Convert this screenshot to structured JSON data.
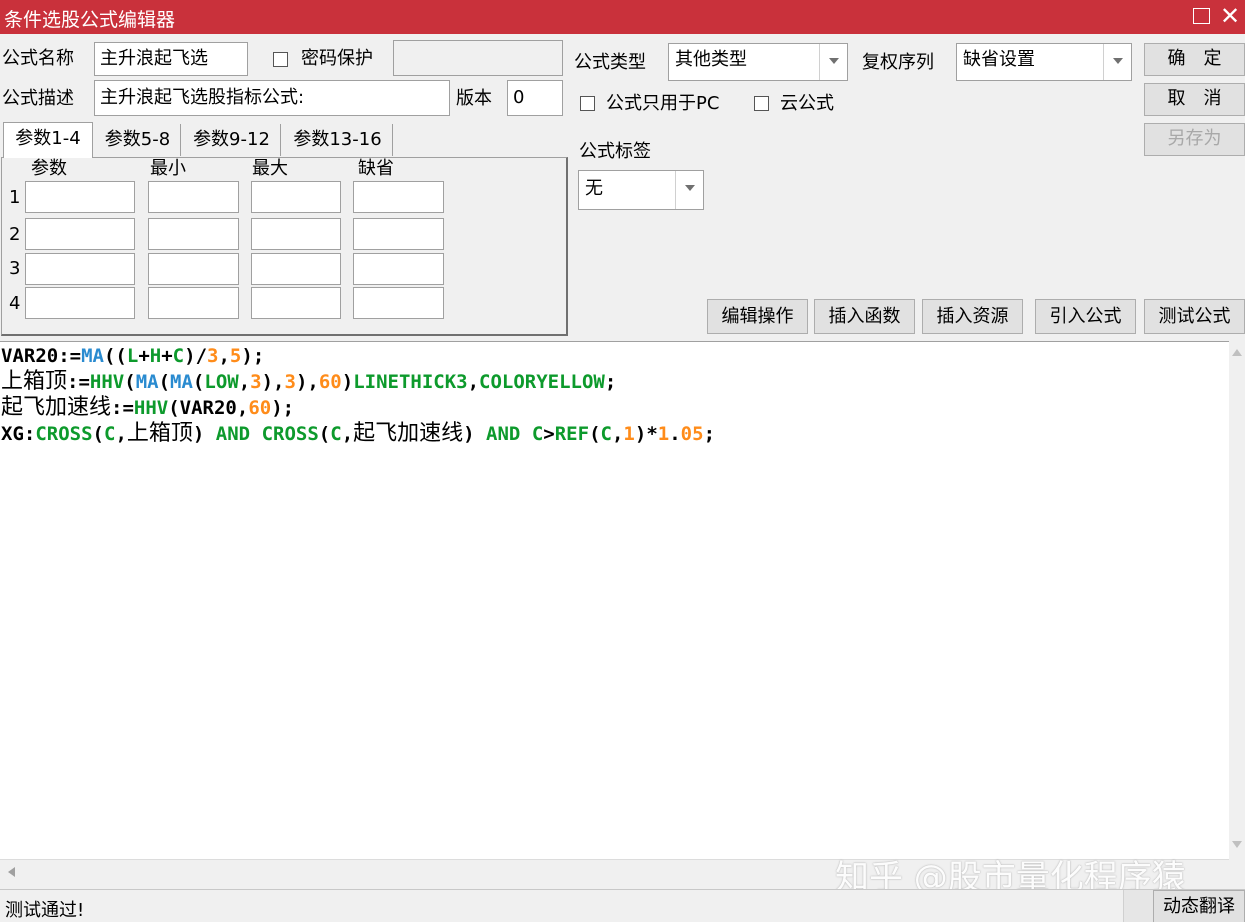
{
  "window": {
    "title": "条件选股公式编辑器"
  },
  "form": {
    "name_label": "公式名称",
    "name_value": "主升浪起飞选",
    "password_label": "密码保护",
    "password_value": "",
    "desc_label": "公式描述",
    "desc_value": "主升浪起飞选股指标公式:",
    "version_label": "版本",
    "version_value": "0",
    "type_label": "公式类型",
    "type_value": "其他类型",
    "adjust_label": "复权序列",
    "adjust_value": "缺省设置",
    "pc_only_label": "公式只用于PC",
    "cloud_label": "云公式",
    "tag_label": "公式标签",
    "tag_value": "无"
  },
  "buttons": {
    "ok": "确　定",
    "cancel": "取　消",
    "save_as": "另存为",
    "edit_ops": "编辑操作",
    "insert_func": "插入函数",
    "insert_resource": "插入资源",
    "import_formula": "引入公式",
    "test_formula": "测试公式",
    "dynamic_translate": "动态翻译"
  },
  "tabs": [
    "参数1-4",
    "参数5-8",
    "参数9-12",
    "参数13-16"
  ],
  "params": {
    "headers": [
      "参数",
      "最小",
      "最大",
      "缺省"
    ],
    "rows": [
      "1",
      "2",
      "3",
      "4"
    ]
  },
  "code": {
    "line1": [
      "VAR20:=",
      "MA",
      "((",
      "L",
      "+",
      "H",
      "+",
      "C",
      ")/",
      "3",
      ",",
      "5",
      ");"
    ],
    "line2": [
      "上箱顶",
      ":=",
      "HHV",
      "(",
      "MA",
      "(",
      "MA",
      "(",
      "LOW",
      ",",
      "3",
      "),",
      "3",
      "),",
      "60",
      ")",
      "LINETHICK3",
      ",",
      "COLORYELLOW",
      ";"
    ],
    "line3": [
      "起飞加速线",
      ":=",
      "HHV",
      "(VAR20,",
      "60",
      ");"
    ],
    "line4": [
      "XG:",
      "CROSS",
      "(",
      "C",
      ",",
      "上箱顶",
      ") ",
      "AND",
      " ",
      "CROSS",
      "(",
      "C",
      ",",
      "起飞加速线",
      ") ",
      "AND",
      " ",
      "C",
      ">",
      "REF",
      "(",
      "C",
      ",",
      "1",
      ")*",
      "1",
      ".",
      "05",
      ";"
    ]
  },
  "status": {
    "text": "测试通过!"
  },
  "watermark": "知乎 @股市量化程序猿",
  "colors": {
    "titlebar": "#c9313b",
    "func_blue": "#2a8bd0",
    "green": "#0d9a2c",
    "number_orange": "#ff8c1a"
  },
  "icons": {
    "maximize": "maximize-icon",
    "close": "close-icon",
    "scroll_up": "scroll-up-icon",
    "scroll_down": "scroll-down-icon",
    "scroll_left": "scroll-left-icon"
  }
}
